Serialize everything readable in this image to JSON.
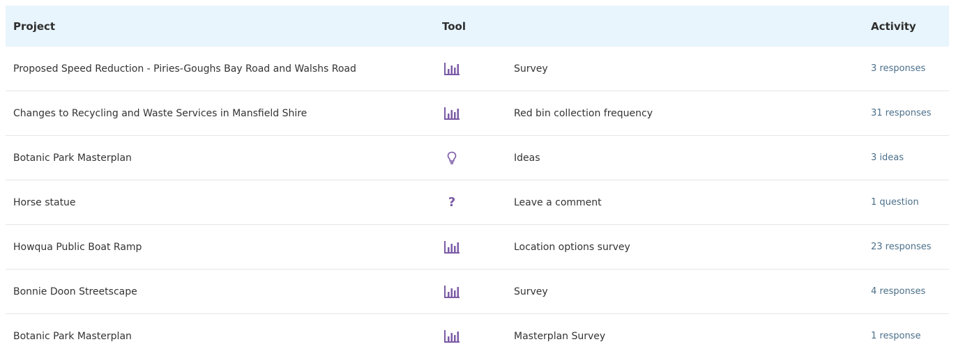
{
  "colors": {
    "header_bg": "#e8f5fc",
    "icon": "#7b5aa6",
    "link": "#4b6f8a",
    "divider": "#e6e6e6"
  },
  "table": {
    "headers": {
      "project": "Project",
      "tool": "Tool",
      "activity": "Activity"
    },
    "rows": [
      {
        "project": "Proposed Speed Reduction - Piries-Goughs Bay Road and Walshs Road",
        "tool_icon": "survey-bar-chart-icon",
        "tool": "Survey",
        "activity": "3 responses"
      },
      {
        "project": "Changes to Recycling and Waste Services in Mansfield Shire",
        "tool_icon": "survey-bar-chart-icon",
        "tool": "Red bin collection frequency",
        "activity": "31 responses"
      },
      {
        "project": "Botanic Park Masterplan",
        "tool_icon": "lightbulb-icon",
        "tool": "Ideas",
        "activity": "3 ideas"
      },
      {
        "project": "Horse statue",
        "tool_icon": "question-mark-icon",
        "tool": "Leave a comment",
        "activity": "1 question"
      },
      {
        "project": "Howqua Public Boat Ramp",
        "tool_icon": "survey-bar-chart-icon",
        "tool": "Location options survey",
        "activity": "23 responses"
      },
      {
        "project": "Bonnie Doon Streetscape",
        "tool_icon": "survey-bar-chart-icon",
        "tool": "Survey",
        "activity": "4 responses"
      },
      {
        "project": "Botanic Park Masterplan",
        "tool_icon": "survey-bar-chart-icon",
        "tool": "Masterplan Survey",
        "activity": "1 response"
      }
    ],
    "question_glyph": "?"
  }
}
